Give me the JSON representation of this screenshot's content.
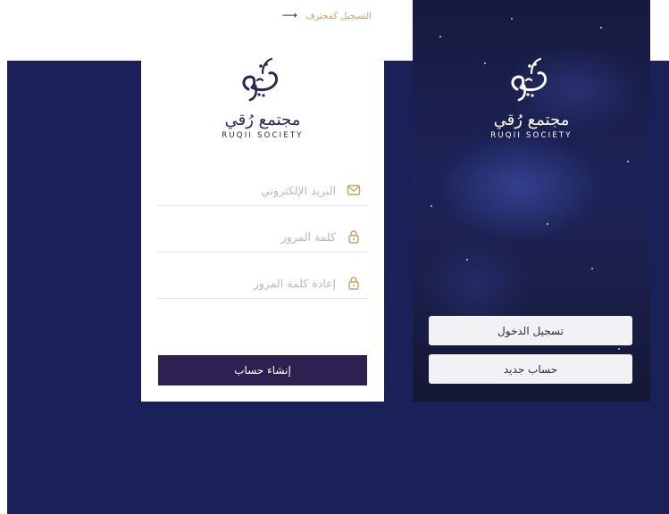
{
  "signup_card": {
    "pro_link_label": "التسجيل كمحترف",
    "logo_text_ar": "مجتمع رُقي",
    "logo_text_en": "RUQII SOCIETY",
    "fields": [
      {
        "placeholder": "البريد الإلكتروني",
        "icon": "envelope-icon"
      },
      {
        "placeholder": "كلمة المرور",
        "icon": "lock-icon"
      },
      {
        "placeholder": "إعادة كلمة المرور",
        "icon": "lock-icon"
      }
    ],
    "submit_label": "إنشاء حساب"
  },
  "splash_panel": {
    "logo_text_ar": "مجتمع رُقي",
    "logo_text_en": "RUQII SOCIETY",
    "login_label": "تسجيل الدخول",
    "new_account_label": "حساب جديد"
  },
  "colors": {
    "brand_dark": "#2c2150",
    "background_navy": "#1a2158",
    "accent_gold": "#c9a05d"
  }
}
